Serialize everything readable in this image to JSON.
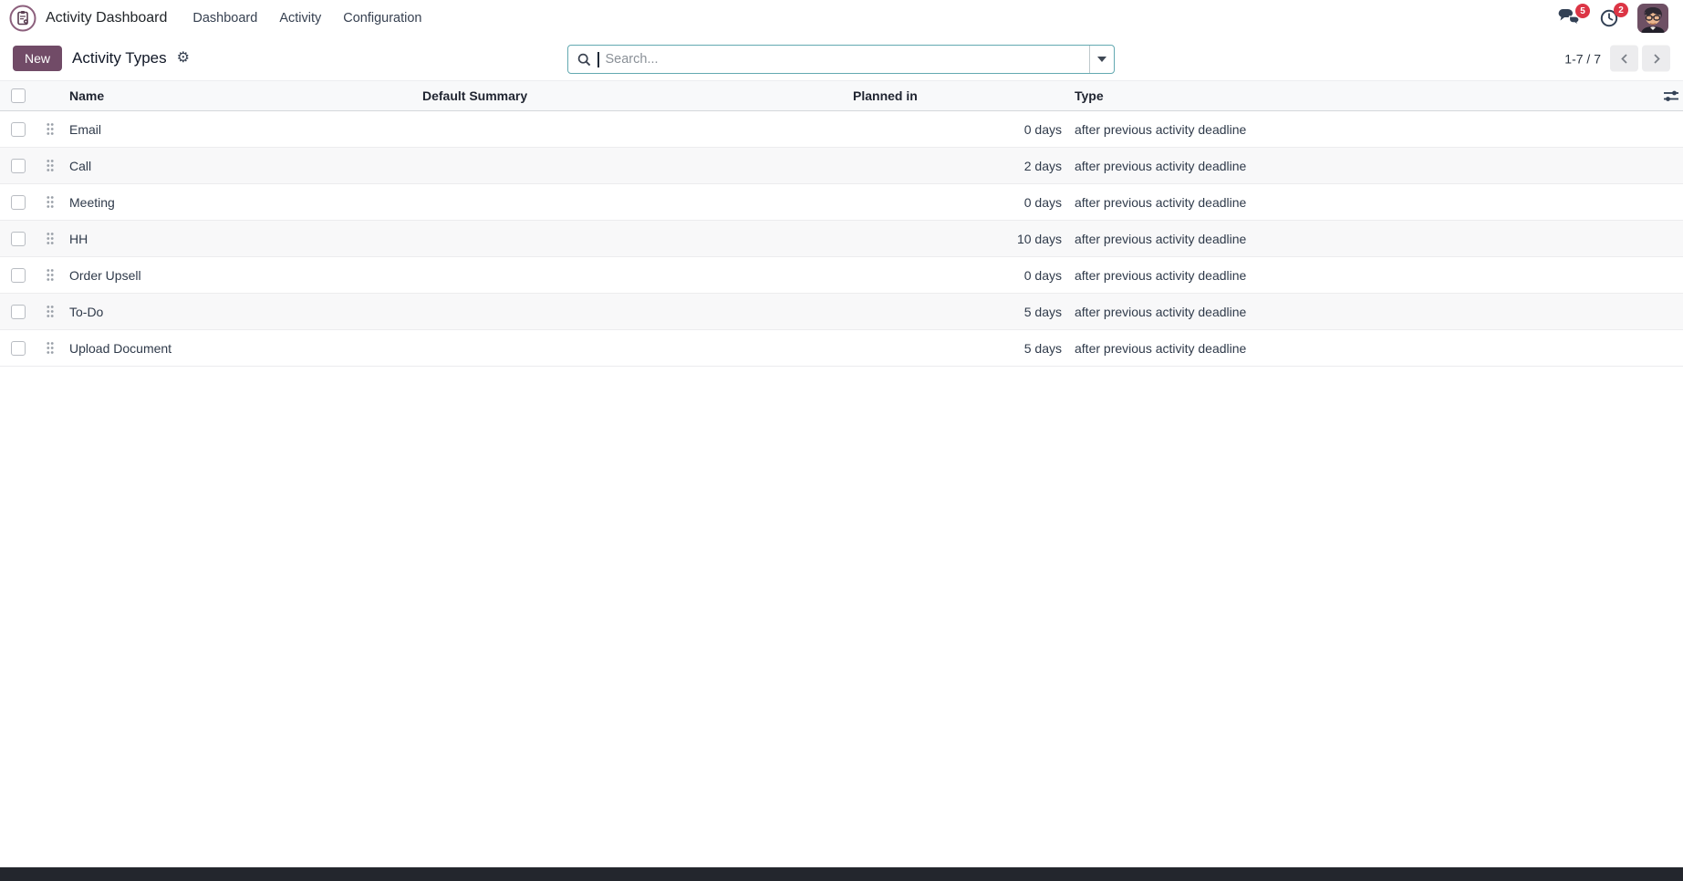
{
  "app": {
    "name": "Activity Dashboard",
    "menu": [
      "Dashboard",
      "Activity",
      "Configuration"
    ],
    "systray": {
      "message_badge": "5",
      "activity_badge": "2"
    }
  },
  "control_panel": {
    "new_button": "New",
    "title": "Activity Types",
    "gear_glyph": "⚙",
    "search": {
      "placeholder": "Search...",
      "value": ""
    },
    "pager": {
      "text": "1-7 / 7"
    }
  },
  "table": {
    "columns": [
      "Name",
      "Default Summary",
      "Planned in",
      "Type"
    ],
    "rows": [
      {
        "name": "Email",
        "default_summary": "",
        "planned_in": "0 days",
        "type": "after previous activity deadline"
      },
      {
        "name": "Call",
        "default_summary": "",
        "planned_in": "2 days",
        "type": "after previous activity deadline"
      },
      {
        "name": "Meeting",
        "default_summary": "",
        "planned_in": "0 days",
        "type": "after previous activity deadline"
      },
      {
        "name": "HH",
        "default_summary": "",
        "planned_in": "10 days",
        "type": "after previous activity deadline"
      },
      {
        "name": "Order Upsell",
        "default_summary": "",
        "planned_in": "0 days",
        "type": "after previous activity deadline"
      },
      {
        "name": "To-Do",
        "default_summary": "",
        "planned_in": "5 days",
        "type": "after previous activity deadline"
      },
      {
        "name": "Upload Document",
        "default_summary": "",
        "planned_in": "5 days",
        "type": "after previous activity deadline"
      }
    ]
  },
  "colors": {
    "primary": "#714B67",
    "logo_ring": "#8c5f7c",
    "badge_red": "#dc3545",
    "search_border": "#63a9b1",
    "icon_dark": "#334155",
    "bottom_bar": "#23262d"
  }
}
